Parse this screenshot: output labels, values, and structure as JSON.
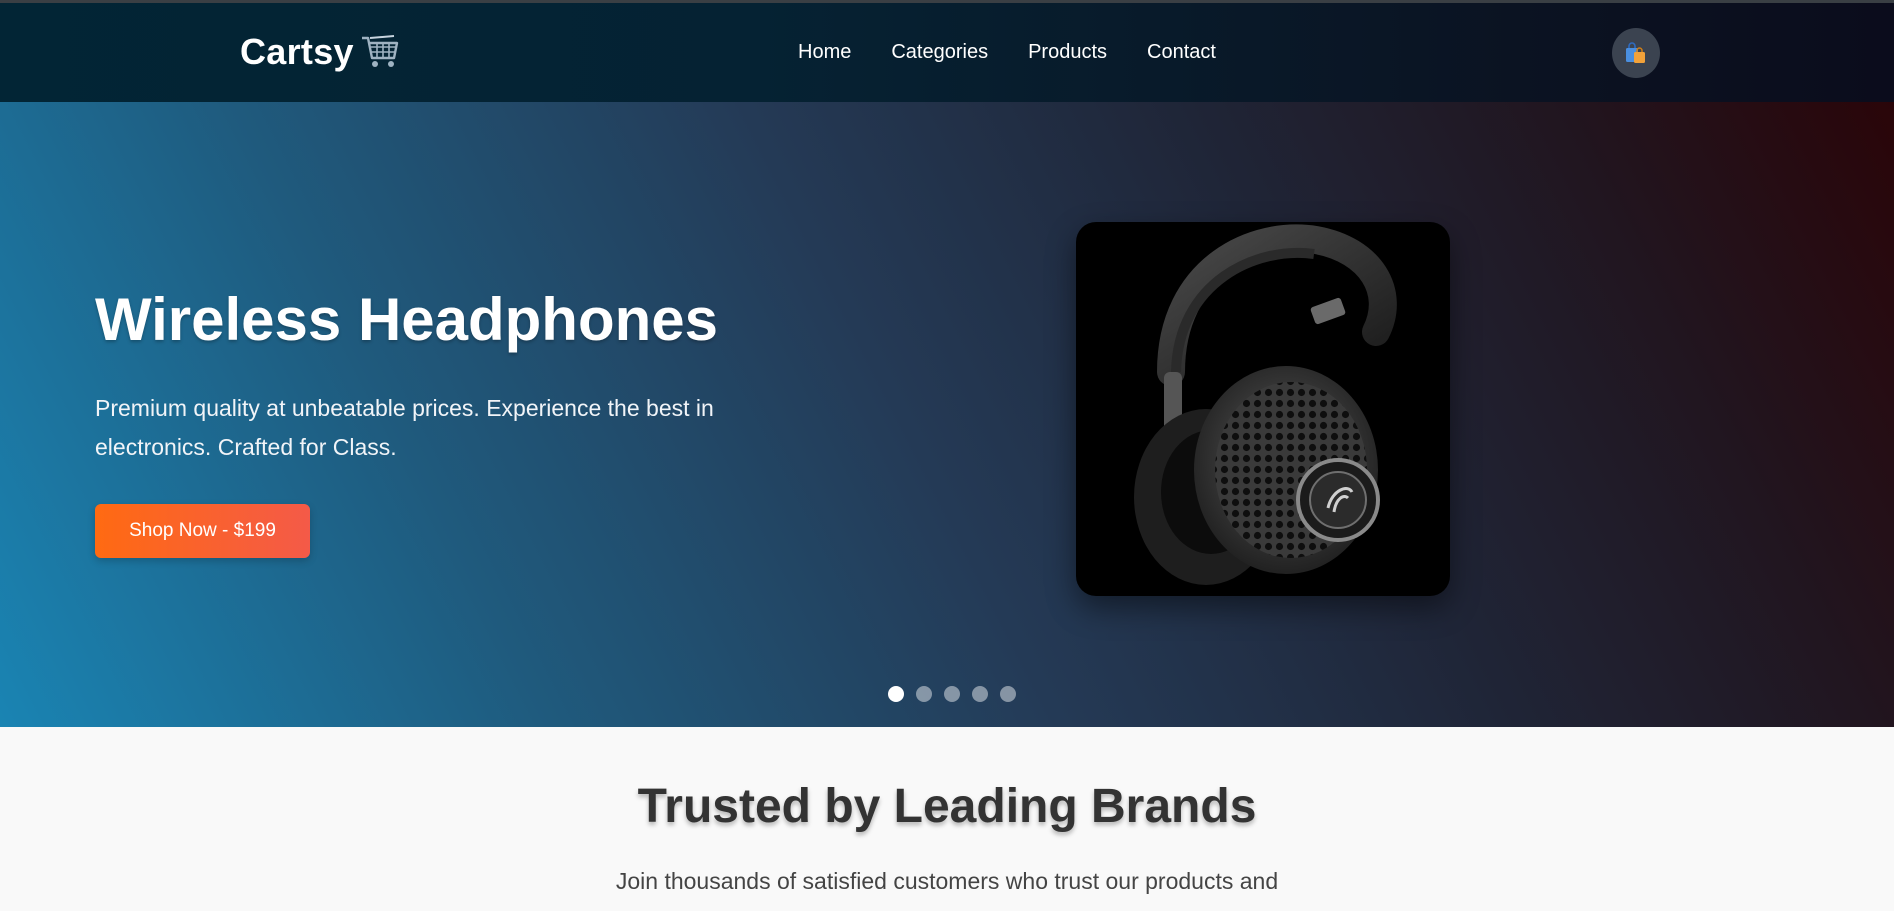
{
  "brand": {
    "name": "Cartsy",
    "icon": "shopping-cart-icon"
  },
  "nav": {
    "links": [
      "Home",
      "Categories",
      "Products",
      "Contact"
    ],
    "cart_icon": "shopping-bags-icon"
  },
  "hero": {
    "title": "Wireless Headphones",
    "description": "Premium quality at unbeatable prices. Experience the best in electronics. Crafted for Class.",
    "cta_label": "Shop Now - $199",
    "product_image": "headphones-image",
    "slide_count": 5,
    "active_slide": 1
  },
  "brands": {
    "title": "Trusted by Leading Brands",
    "description": "Join thousands of satisfied customers who trust our products and"
  },
  "colors": {
    "nav_bg": "#032433",
    "cta_start": "#ff6a12",
    "cta_end": "#f45a48",
    "hero_left": "#1a84b3",
    "hero_right": "#2a0509"
  }
}
